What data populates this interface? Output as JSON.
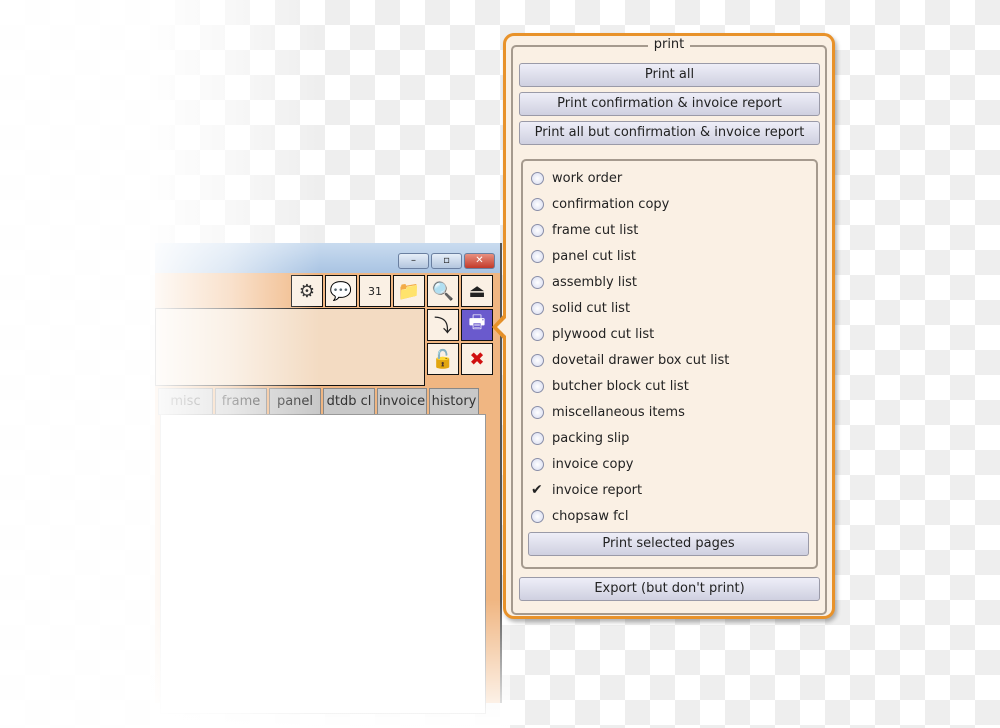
{
  "window": {
    "controls": {
      "minimize": "–",
      "maximize": "▫",
      "close": "✕"
    },
    "toolbar": [
      {
        "name": "settings-gear-icon",
        "glyph": "⚙"
      },
      {
        "name": "chat-icon",
        "glyph": "💬"
      },
      {
        "name": "calendar-icon",
        "glyph": "31"
      },
      {
        "name": "folder-icon",
        "glyph": "📁"
      },
      {
        "name": "preview-search-icon",
        "glyph": "🔍"
      },
      {
        "name": "tray-icon",
        "glyph": "⏏"
      }
    ],
    "side_buttons": [
      {
        "name": "save-download-icon",
        "glyph": "⤵"
      },
      {
        "name": "printer-icon",
        "glyph": "🖶"
      },
      {
        "name": "unlock-icon",
        "glyph": "🔓"
      },
      {
        "name": "delete-icon",
        "glyph": "✖"
      }
    ],
    "tabs": [
      "misc",
      "frame cl",
      "panel cl",
      "dtdb cl",
      "invoice",
      "history"
    ]
  },
  "print_popup": {
    "title": "print",
    "buttons": [
      "Print all",
      "Print confirmation & invoice report",
      "Print all but confirmation & invoice report"
    ],
    "options": [
      {
        "label": "work order",
        "checked": false
      },
      {
        "label": "confirmation copy",
        "checked": false
      },
      {
        "label": "frame cut list",
        "checked": false
      },
      {
        "label": "panel cut list",
        "checked": false
      },
      {
        "label": "assembly list",
        "checked": false
      },
      {
        "label": "solid cut list",
        "checked": false
      },
      {
        "label": "plywood cut list",
        "checked": false
      },
      {
        "label": "dovetail drawer box cut list",
        "checked": false
      },
      {
        "label": "butcher block cut list",
        "checked": false
      },
      {
        "label": "miscellaneous items",
        "checked": false
      },
      {
        "label": "packing slip",
        "checked": false
      },
      {
        "label": "invoice copy",
        "checked": false
      },
      {
        "label": "invoice report",
        "checked": true
      },
      {
        "label": "chopsaw fcl",
        "checked": false
      }
    ],
    "print_selected": "Print selected pages",
    "export": "Export (but don't print)"
  },
  "colors": {
    "accent": "#e8922a",
    "selected_tool": "#6a5acd",
    "panel_bg": "#faf0e4"
  }
}
